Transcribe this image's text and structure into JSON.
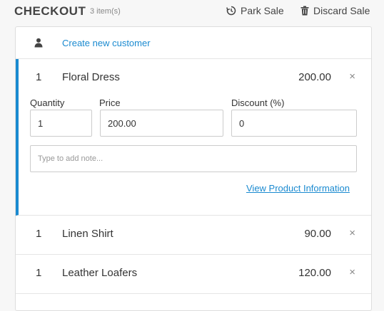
{
  "header": {
    "title": "CHECKOUT",
    "item_count": "3 item(s)",
    "park_label": "Park Sale",
    "discard_label": "Discard Sale"
  },
  "customer": {
    "link_label": "Create new customer",
    "icon": "user-icon"
  },
  "active_item": {
    "qty": "1",
    "name": "Floral Dress",
    "price": "200.00",
    "remove": "×",
    "quantity_label": "Quantity",
    "price_label": "Price",
    "discount_label": "Discount (%)",
    "quantity_value": "1",
    "price_value": "200.00",
    "discount_value": "0",
    "note_placeholder": "Type to add note...",
    "view_info_label": "View Product Information"
  },
  "items": [
    {
      "qty": "1",
      "name": "Linen Shirt",
      "price": "90.00",
      "remove": "×"
    },
    {
      "qty": "1",
      "name": "Leather Loafers",
      "price": "120.00",
      "remove": "×"
    }
  ],
  "colors": {
    "accent": "#1a8ad0",
    "border": "#dddddd",
    "background": "#f7f7f7"
  }
}
